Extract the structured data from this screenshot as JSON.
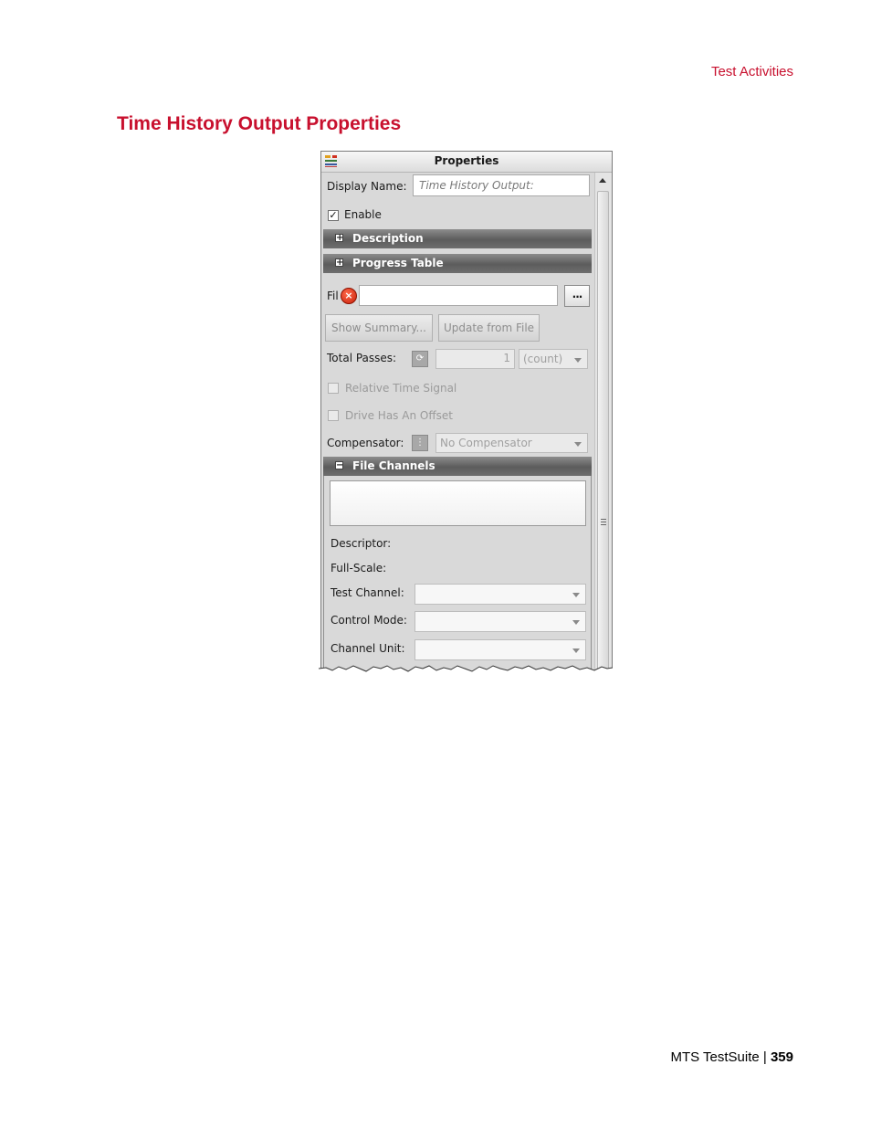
{
  "page": {
    "running_header": "Test Activities",
    "title": "Time History Output Properties",
    "footer_product": "MTS TestSuite",
    "footer_separator": " | ",
    "footer_page": "359"
  },
  "panel": {
    "title": "Properties",
    "display_name_label": "Display Name:",
    "display_name_value": "Time History Output:",
    "enable_label": "Enable",
    "enable_checked": true,
    "description_section": "Description",
    "progress_table_section": "Progress Table",
    "file_label": "Fil",
    "file_value": "",
    "browse_label": "...",
    "show_summary_button": "Show Summary...",
    "update_from_file_button": "Update from File",
    "total_passes_label": "Total Passes:",
    "total_passes_value": "1",
    "total_passes_unit": "(count)",
    "relative_time_signal_label": "Relative Time Signal",
    "drive_offset_label": "Drive Has An Offset",
    "compensator_label": "Compensator:",
    "compensator_value": "No Compensator",
    "file_channels_section": "File Channels",
    "descriptor_label": "Descriptor:",
    "full_scale_label": "Full-Scale:",
    "test_channel_label": "Test Channel:",
    "control_mode_label": "Control Mode:",
    "channel_unit_label": "Channel Unit:",
    "colors": {
      "accent": "#c8102e",
      "panel_bg": "#d9d9d9",
      "section_bar": "#6e6e6e"
    },
    "icons": [
      "properties-icon",
      "expand-icon",
      "collapse-icon",
      "error-icon",
      "ellipsis-icon",
      "variable-icon",
      "dropdown-arrow-icon",
      "scroll-up-icon"
    ]
  }
}
